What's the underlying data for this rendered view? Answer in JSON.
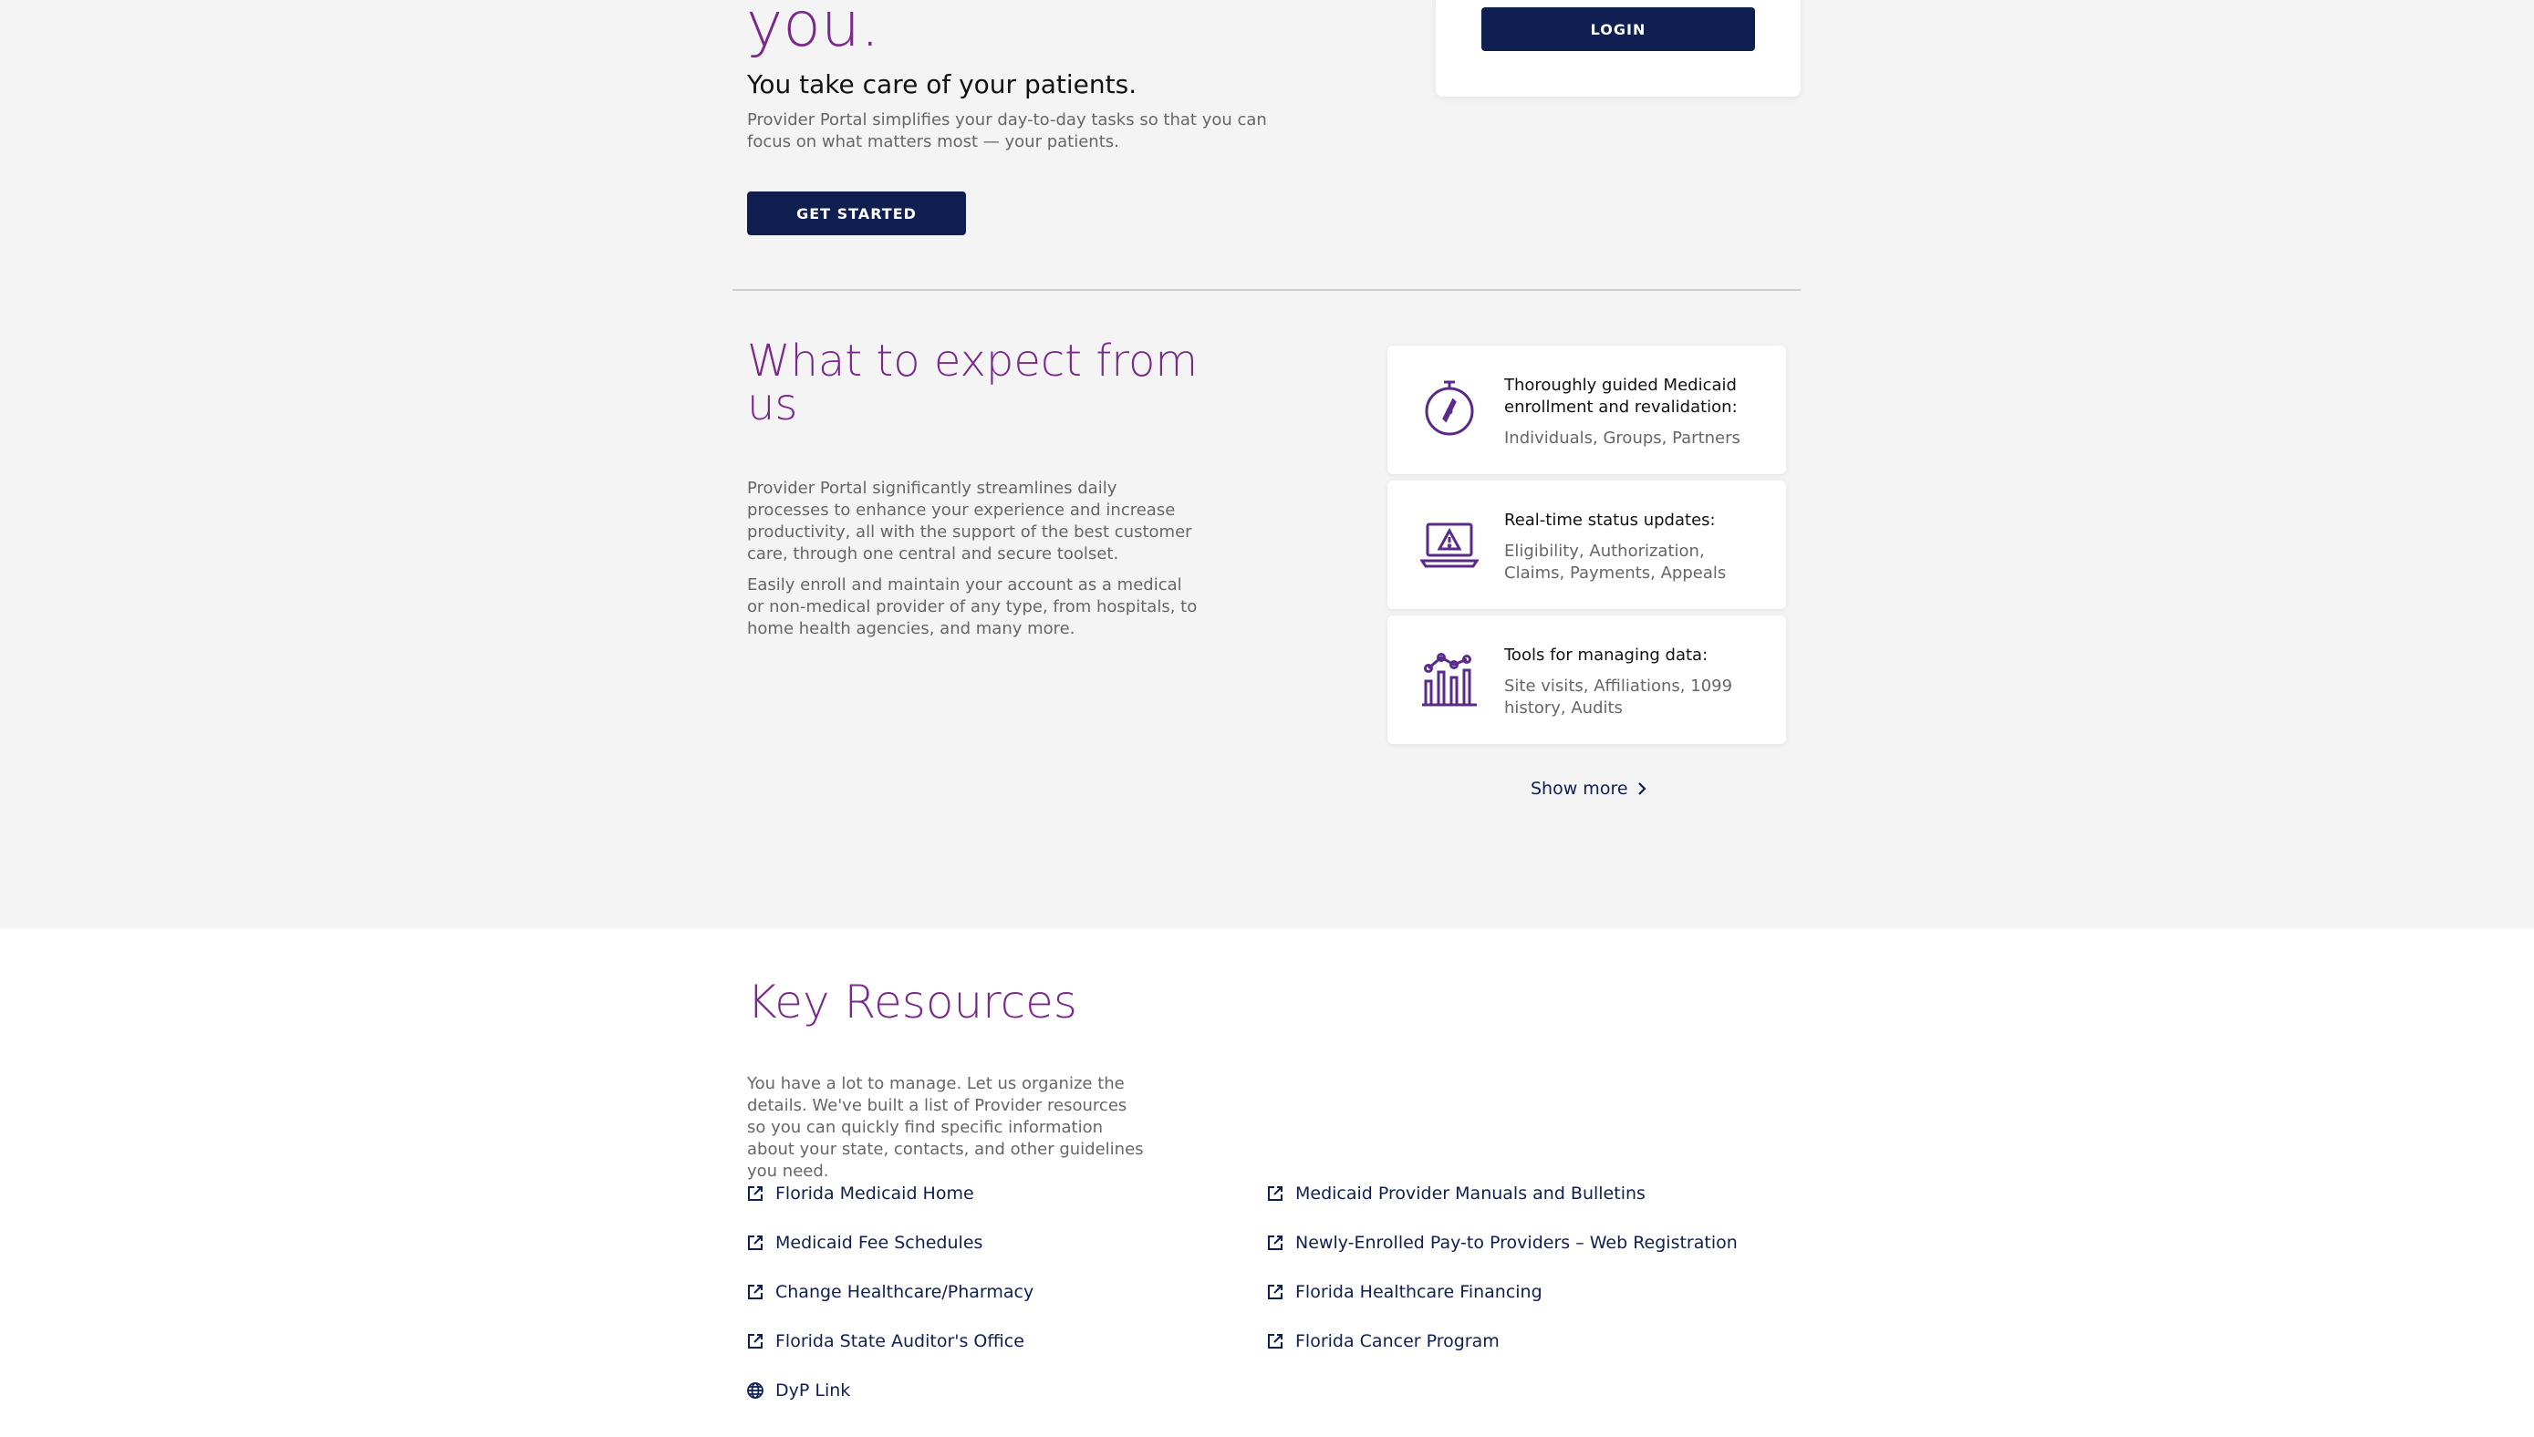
{
  "hero": {
    "title_tail": "you.",
    "subtitle": "You take care of your patients.",
    "description": "Provider Portal simplifies your day-to-day tasks so that you can focus on what matters most — your patients.",
    "cta_label": "GET STARTED"
  },
  "login": {
    "button_label": "LOGIN"
  },
  "expect": {
    "title": "What to expect from us",
    "paragraph1": "Provider Portal significantly streamlines daily processes to enhance your experience and increase productivity, all with the support of the best customer care, through one central and secure toolset.",
    "paragraph2": "Easily enroll and maintain your account as a medical or non-medical provider of any type, from hospitals, to home health agencies, and many more.",
    "features": [
      {
        "icon": "compass-icon",
        "title": "Thoroughly guided Medicaid enrollment and revalidation:",
        "desc": "Individuals, Groups, Partners"
      },
      {
        "icon": "laptop-warning-icon",
        "title": "Real-time status updates:",
        "desc": "Eligibility, Authorization, Claims, Payments, Appeals"
      },
      {
        "icon": "data-chart-icon",
        "title": "Tools for managing data:",
        "desc": "Site visits, Affiliations, 1099 history, Audits"
      }
    ],
    "show_more": "Show more"
  },
  "resources": {
    "title": "Key Resources",
    "description": "You have a lot to manage. Let us organize the details. We've built a list of Provider resources so you can quickly find specific information about your state, contacts, and other guidelines you need.",
    "links_left": [
      "Florida Medicaid Home",
      "Medicaid Fee Schedules",
      "Change Healthcare/Pharmacy",
      "Florida State Auditor's Office",
      "DyP Link"
    ],
    "links_right": [
      "Medicaid Provider Manuals and Bulletins",
      "Newly-Enrolled Pay-to Providers – Web Registration",
      "Florida Healthcare Financing",
      "Florida Cancer Program"
    ]
  },
  "colors": {
    "accent": "#7a2a8a",
    "primary": "#0f1f52",
    "background": "#f4f4f4"
  }
}
